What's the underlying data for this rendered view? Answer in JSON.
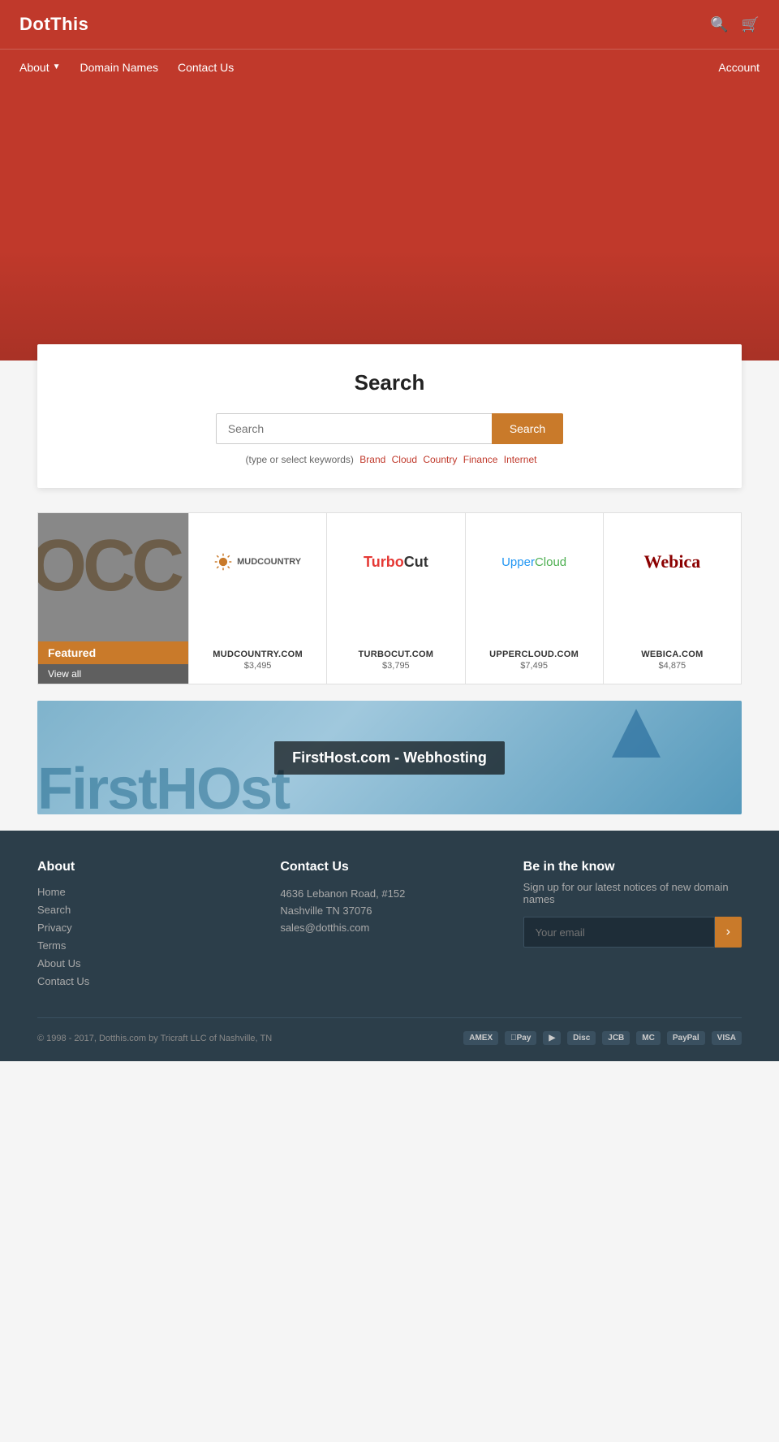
{
  "site": {
    "name": "DotThis"
  },
  "nav": {
    "about": "About",
    "domain_names": "Domain Names",
    "contact_us": "Contact Us",
    "account": "Account"
  },
  "search": {
    "title": "Search",
    "placeholder": "Search",
    "button_label": "Search",
    "hint": "(type or select keywords)",
    "keywords": [
      "Brand",
      "Cloud",
      "Country",
      "Finance",
      "Internet"
    ]
  },
  "featured": {
    "label": "Featured",
    "view_all": "View all",
    "bg_text": "OCC"
  },
  "domains": [
    {
      "name": "MUDCOUNTRY.COM",
      "price": "$3,495",
      "logo_text": "MUDCOUNTRY",
      "type": "mudcountry"
    },
    {
      "name": "TURBOCUT.COM",
      "price": "$3,795",
      "logo_text": "TurboCut",
      "type": "turbocut"
    },
    {
      "name": "UPPERCLOUD.COM",
      "price": "$7,495",
      "logo_text": "UpperCloud",
      "type": "uppercloud"
    },
    {
      "name": "WEBICA.COM",
      "price": "$4,875",
      "logo_text": "Webica",
      "type": "webica"
    }
  ],
  "banner": {
    "title": "FirstHost.com - Webhosting",
    "bg_text": "FirstHOst"
  },
  "footer": {
    "about_title": "About",
    "about_links": [
      "Home",
      "Search",
      "Privacy",
      "Terms",
      "About Us",
      "Contact Us"
    ],
    "contact_title": "Contact Us",
    "address_line1": "4636 Lebanon Road, #152",
    "address_line2": "Nashville TN 37076",
    "email": "sales@dotthis.com",
    "subscribe_title": "Be in the know",
    "subscribe_text": "Sign up for our latest notices of new domain names",
    "email_placeholder": "Your email",
    "subscribe_button": "›",
    "copyright": "© 1998 - 2017, Dotthis.com by Tricraft LLC of Nashville, TN",
    "payment_methods": [
      "AMEX",
      "Apple Pay",
      "Diners",
      "Discover",
      "JCB",
      "Master",
      "PayPal",
      "VISA"
    ]
  }
}
